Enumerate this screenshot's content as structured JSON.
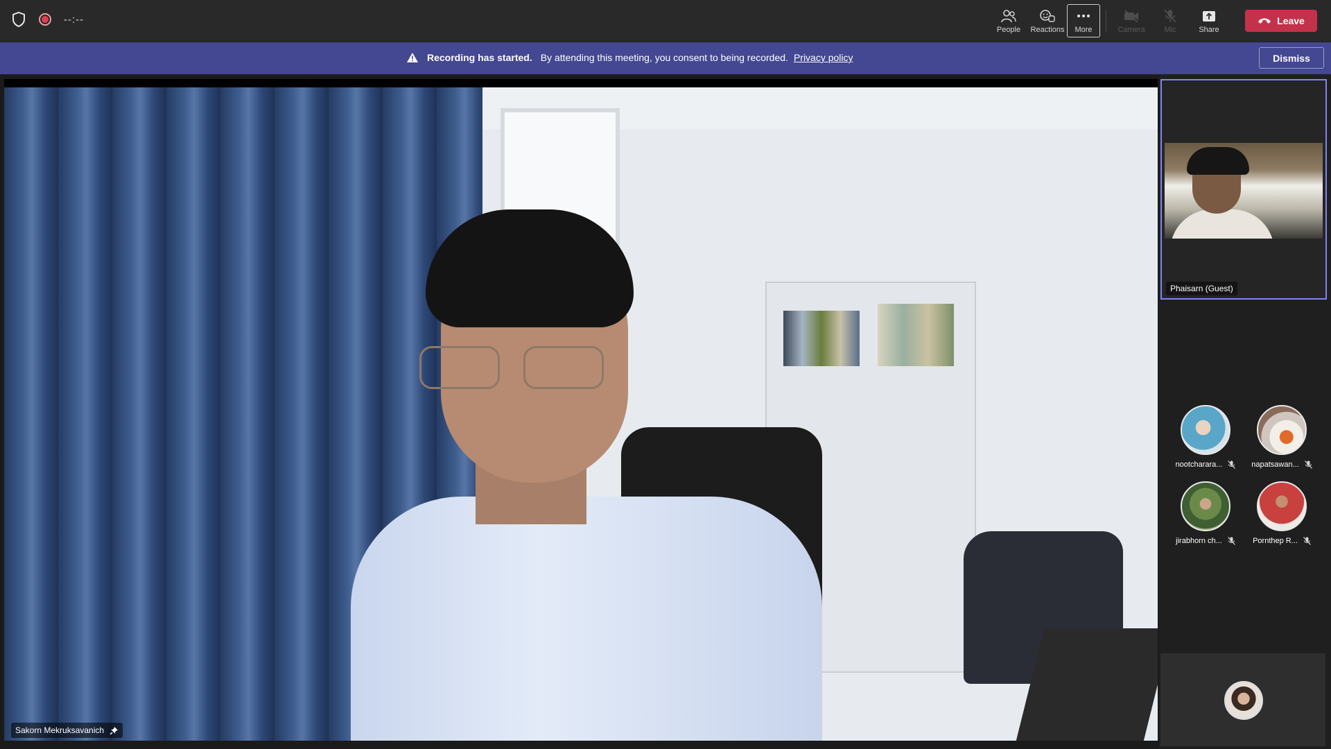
{
  "topbar": {
    "timer": "--:--",
    "buttons": {
      "people": "People",
      "reactions": "Reactions",
      "more": "More",
      "camera": "Camera",
      "mic": "Mic",
      "share": "Share"
    },
    "leave_label": "Leave",
    "leave_color": "#c4314b"
  },
  "banner": {
    "title": "Recording has started.",
    "message": "By attending this meeting, you consent to being recorded.",
    "link": "Privacy policy",
    "dismiss_label": "Dismiss",
    "background": "#444791"
  },
  "main_video": {
    "participant_name": "Sakorn Mekruksavanich",
    "pinned": true
  },
  "featured": {
    "participant_name": "Phaisarn (Guest)",
    "highlight_color": "#7f85f5"
  },
  "participants": [
    {
      "name": "nootcharara...",
      "muted": true
    },
    {
      "name": "napatsawan...",
      "muted": true
    },
    {
      "name": "jirabhorn ch...",
      "muted": true
    },
    {
      "name": "Pornthep R...",
      "muted": true
    }
  ],
  "icons": [
    "shield-icon",
    "record-icon",
    "people-icon",
    "reactions-icon",
    "more-icon",
    "camera-off-icon",
    "mic-off-icon",
    "share-icon",
    "phone-hangup-icon",
    "warning-icon",
    "pin-icon",
    "mic-muted-icon"
  ]
}
